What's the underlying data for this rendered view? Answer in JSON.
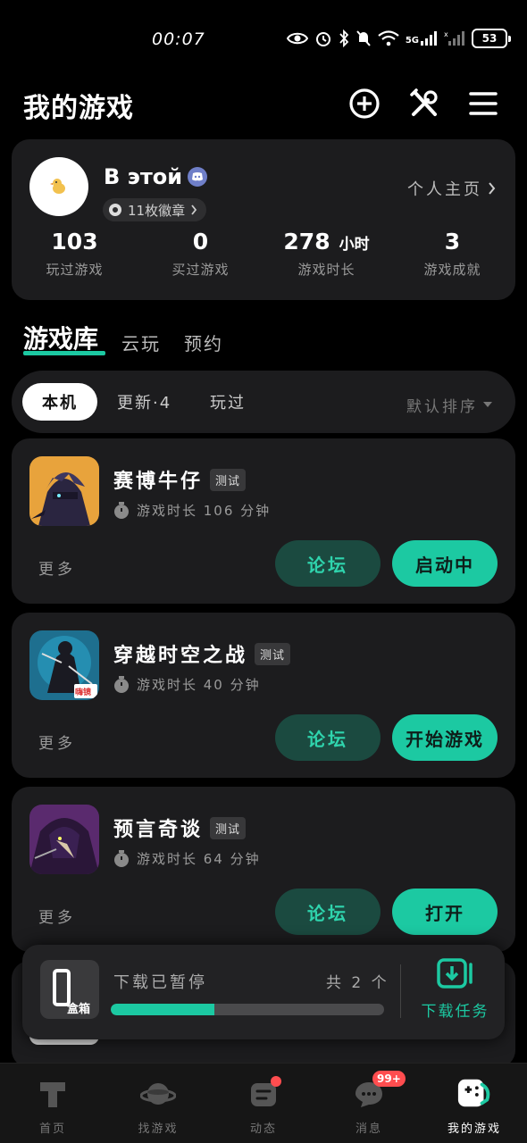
{
  "status_bar": {
    "time": "00:07",
    "network": "5G",
    "battery": "53"
  },
  "header": {
    "title": "我的游戏",
    "icons": [
      "add-circle-icon",
      "tools-icon",
      "menu-icon"
    ]
  },
  "profile": {
    "username": "В этой",
    "medals": "11枚徽章",
    "home_link": "个人主页",
    "stats": [
      {
        "value": "103",
        "unit": "",
        "label": "玩过游戏"
      },
      {
        "value": "0",
        "unit": "",
        "label": "买过游戏"
      },
      {
        "value": "278",
        "unit": "小时",
        "label": "游戏时长"
      },
      {
        "value": "3",
        "unit": "",
        "label": "游戏成就"
      }
    ]
  },
  "section_tabs": [
    "游戏库",
    "云玩",
    "预约"
  ],
  "filters": {
    "pills": [
      "本机",
      "更新·4",
      "玩过"
    ],
    "sort": "默认排序"
  },
  "games": [
    {
      "title": "赛博牛仔",
      "tag": "测试",
      "playtime": "游戏时长 106 分钟",
      "more": "更多",
      "forum": "论坛",
      "action": "启动中"
    },
    {
      "title": "穿越时空之战",
      "tag": "测试",
      "playtime": "游戏时长 40 分钟",
      "more": "更多",
      "forum": "论坛",
      "action": "开始游戏",
      "icon_badge": "嗨镜"
    },
    {
      "title": "预言奇谈",
      "tag": "测试",
      "playtime": "游戏时长 64 分钟",
      "more": "更多",
      "forum": "论坛",
      "action": "打开"
    }
  ],
  "download": {
    "logo_text": "盒箱",
    "status": "下载已暂停",
    "count": "共 2 个",
    "progress": 0.38,
    "task_label": "下载任务"
  },
  "bottom_nav": [
    {
      "label": "首页",
      "icon": "home-icon"
    },
    {
      "label": "找游戏",
      "icon": "planet-icon"
    },
    {
      "label": "动态",
      "icon": "feed-icon",
      "dot": true
    },
    {
      "label": "消息",
      "icon": "message-icon",
      "badge": "99+"
    },
    {
      "label": "我的游戏",
      "icon": "gamepad-icon",
      "active": true
    }
  ],
  "colors": {
    "accent": "#1cc9a2",
    "forum_bg": "#1b4a40",
    "card_bg": "#1c1c1e",
    "badge_red": "#ff4d4f"
  }
}
